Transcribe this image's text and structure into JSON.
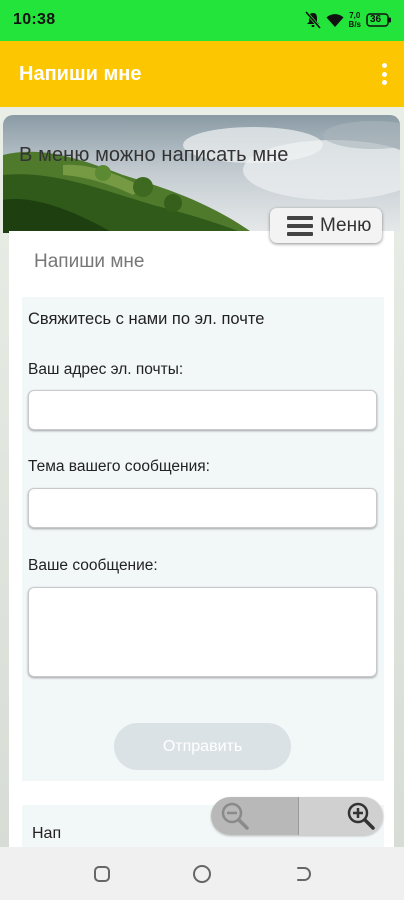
{
  "status_bar": {
    "time": "10:38",
    "icons": [
      "mute-icon",
      "wifi-icon",
      "signal-icon",
      "battery-icon"
    ],
    "network_speed_top": "7,0",
    "network_speed_bottom": "B/s",
    "battery_level": "36"
  },
  "app_bar": {
    "title": "Напиши мне",
    "menu_icon": "overflow-menu-icon",
    "background_color": "#fcc600"
  },
  "banner": {
    "text": "В меню можно написать мне"
  },
  "menu_button": {
    "label": "Меню",
    "icon": "hamburger-icon"
  },
  "page": {
    "title": "Напиши мне"
  },
  "contact_form": {
    "heading": "Свяжитесь с нами по эл. почте",
    "email": {
      "label": "Ваш адрес эл. почты:",
      "value": "",
      "placeholder": ""
    },
    "subject": {
      "label": "Тема вашего сообщения:",
      "value": "",
      "placeholder": ""
    },
    "message": {
      "label": "Ваше сообщение:",
      "value": "",
      "placeholder": ""
    },
    "submit_label": "Отправить"
  },
  "second_panel": {
    "label": "Нап"
  },
  "zoom": {
    "zoom_out_icon": "zoom-out-icon",
    "zoom_in_icon": "zoom-in-icon"
  },
  "nav_bar": {
    "buttons": [
      "recent-apps-icon",
      "home-icon",
      "back-icon"
    ]
  },
  "colors": {
    "status_bar": "#22e43a",
    "app_bar": "#fcc600",
    "form_panel": "#f2f7f8",
    "submit_button": "#dbe2e5"
  }
}
